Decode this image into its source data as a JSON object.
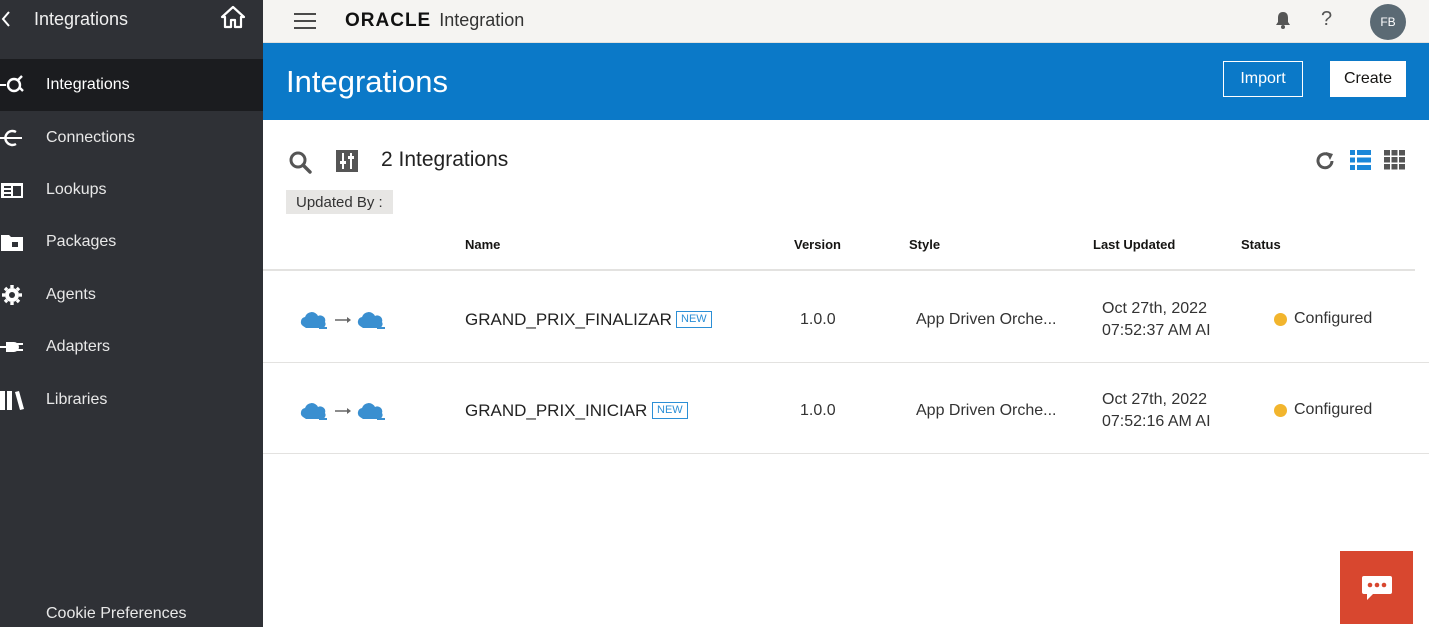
{
  "sidebar": {
    "title": "Integrations",
    "items": [
      {
        "label": "Integrations",
        "icon": "integrations-icon",
        "active": true
      },
      {
        "label": "Connections",
        "icon": "connections-icon"
      },
      {
        "label": "Lookups",
        "icon": "lookups-icon"
      },
      {
        "label": "Packages",
        "icon": "packages-icon"
      },
      {
        "label": "Agents",
        "icon": "gear-icon"
      },
      {
        "label": "Adapters",
        "icon": "adapters-icon"
      },
      {
        "label": "Libraries",
        "icon": "libraries-icon"
      }
    ],
    "cookie_label": "Cookie Preferences"
  },
  "topbar": {
    "brand": "ORACLE",
    "product": "Integration",
    "avatar_initials": "FB"
  },
  "header": {
    "title": "Integrations",
    "import_label": "Import",
    "create_label": "Create"
  },
  "toolbar": {
    "count_label": "2 Integrations",
    "updated_by_label": "Updated By :"
  },
  "table": {
    "columns": [
      "Name",
      "Version",
      "Style",
      "Last Updated",
      "Status"
    ],
    "rows": [
      {
        "name": "GRAND_PRIX_FINALIZAR",
        "tag": "NEW",
        "version": "1.0.0",
        "style": "App Driven Orche...",
        "updated_date": "Oct 27th, 2022",
        "updated_time": "07:52:37 AM AI",
        "status": "Configured"
      },
      {
        "name": "GRAND_PRIX_INICIAR",
        "tag": "NEW",
        "version": "1.0.0",
        "style": "App Driven Orche...",
        "updated_date": "Oct 27th, 2022",
        "updated_time": "07:52:16 AM AI",
        "status": "Configured"
      }
    ]
  },
  "colors": {
    "sidebar_bg": "#2f3136",
    "header_blue": "#0b79c8",
    "status_configured": "#f2b52d",
    "chat_red": "#d8472f",
    "link_blue": "#2c8fd6"
  }
}
